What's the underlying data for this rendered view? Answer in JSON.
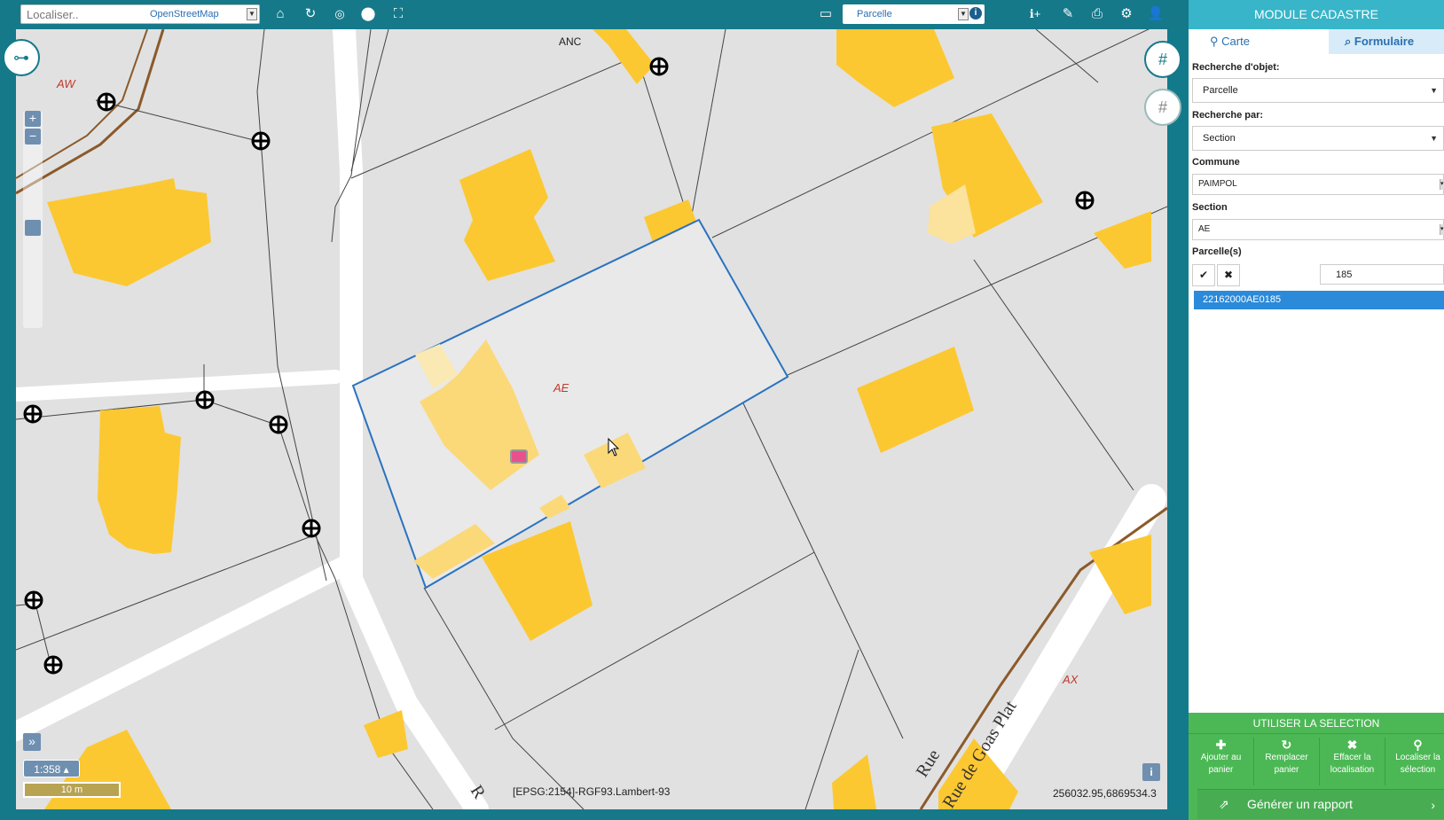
{
  "toolbar": {
    "locate_placeholder": "Localiser..",
    "basemap": "OpenStreetMap",
    "layer": "Parcelle",
    "icons": [
      "home-icon",
      "refresh-icon",
      "globe-icon",
      "marker-icon",
      "fullscreen-icon",
      "ruler-icon",
      "info-icon",
      "draw-icon",
      "print-icon",
      "gear-icon",
      "user-icon"
    ]
  },
  "map": {
    "scale": "1:358 ▴",
    "scale_bar": "10 m",
    "projection": "[EPSG:2154]-RGF93.Lambert-93",
    "coordinates": "256032.95,6869534.3",
    "labels": {
      "aw": "AW",
      "anc": "ANC",
      "ae": "AE",
      "ax": "AX",
      "street_rue": "Rue",
      "street_name": "Rue de Goas Plat",
      "street_fragment": "R"
    },
    "colors": {
      "background": "#e1e1e1",
      "building": "#fcc832",
      "selection": "#2a72c0",
      "road": "#ffffff",
      "rail": "#8b5a2b"
    }
  },
  "panel": {
    "title": "MODULE CADASTRE",
    "tabs": {
      "carte": "Carte",
      "formulaire": "Formulaire"
    },
    "search_object_label": "Recherche d'objet:",
    "search_object_value": "Parcelle",
    "search_by_label": "Recherche par:",
    "search_by_value": "Section",
    "commune_label": "Commune",
    "commune_value": "PAIMPOL",
    "section_label": "Section",
    "section_value": "AE",
    "parcels_label": "Parcelle(s)",
    "parcel_input": "185",
    "result": "22162000AE0185",
    "use_selection": {
      "title": "UTILISER LA SELECTION",
      "add": "Ajouter au panier",
      "replace": "Remplacer panier",
      "clear": "Effacer la localisation",
      "locate": "Localiser la sélection"
    },
    "report": "Générer un rapport"
  }
}
